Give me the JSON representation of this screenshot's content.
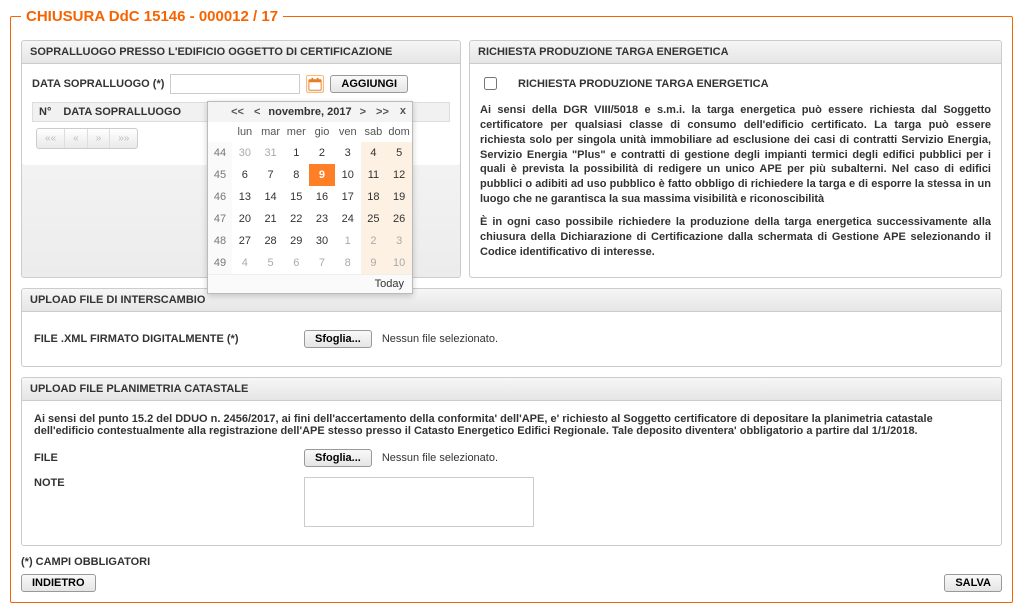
{
  "title": "CHIUSURA DdC 15146 - 000012 / 17",
  "sopralluogo": {
    "panel_title": "SOPRALLUOGO PRESSO L'EDIFICIO OGGETTO DI CERTIFICAZIONE",
    "date_label": "DATA SOPRALLUOGO (*)",
    "date_value": "",
    "aggiungi": "AGGIUNGI",
    "table_n": "N°",
    "table_date": "DATA SOPRALLUOGO",
    "nav_first": "««",
    "nav_prev": "«",
    "nav_next": "»",
    "nav_last": "»»"
  },
  "calendar": {
    "first": "<<",
    "prev": "<",
    "title": "novembre, 2017",
    "next": ">",
    "last": ">>",
    "close": "x",
    "dow": [
      "lun",
      "mar",
      "mer",
      "gio",
      "ven",
      "sab",
      "dom"
    ],
    "weeks": [
      {
        "wk": "44",
        "days": [
          {
            "d": "30",
            "o": true
          },
          {
            "d": "31",
            "o": true
          },
          {
            "d": "1"
          },
          {
            "d": "2"
          },
          {
            "d": "3"
          },
          {
            "d": "4",
            "we": true
          },
          {
            "d": "5",
            "we": true
          }
        ]
      },
      {
        "wk": "45",
        "days": [
          {
            "d": "6"
          },
          {
            "d": "7"
          },
          {
            "d": "8"
          },
          {
            "d": "9",
            "today": true
          },
          {
            "d": "10"
          },
          {
            "d": "11",
            "we": true
          },
          {
            "d": "12",
            "we": true
          }
        ]
      },
      {
        "wk": "46",
        "days": [
          {
            "d": "13"
          },
          {
            "d": "14"
          },
          {
            "d": "15"
          },
          {
            "d": "16"
          },
          {
            "d": "17"
          },
          {
            "d": "18",
            "we": true
          },
          {
            "d": "19",
            "we": true
          }
        ]
      },
      {
        "wk": "47",
        "days": [
          {
            "d": "20"
          },
          {
            "d": "21"
          },
          {
            "d": "22"
          },
          {
            "d": "23"
          },
          {
            "d": "24"
          },
          {
            "d": "25",
            "we": true
          },
          {
            "d": "26",
            "we": true
          }
        ]
      },
      {
        "wk": "48",
        "days": [
          {
            "d": "27"
          },
          {
            "d": "28"
          },
          {
            "d": "29"
          },
          {
            "d": "30"
          },
          {
            "d": "1",
            "o": true
          },
          {
            "d": "2",
            "o": true,
            "we": true
          },
          {
            "d": "3",
            "o": true,
            "we": true
          }
        ]
      },
      {
        "wk": "49",
        "days": [
          {
            "d": "4",
            "o": true
          },
          {
            "d": "5",
            "o": true
          },
          {
            "d": "6",
            "o": true
          },
          {
            "d": "7",
            "o": true
          },
          {
            "d": "8",
            "o": true
          },
          {
            "d": "9",
            "o": true,
            "we": true
          },
          {
            "d": "10",
            "o": true,
            "we": true
          }
        ]
      }
    ],
    "today": "Today"
  },
  "richiesta": {
    "panel_title": "RICHIESTA PRODUZIONE TARGA ENERGETICA",
    "checkbox_label": "RICHIESTA PRODUZIONE TARGA ENERGETICA",
    "p1": "Ai sensi della DGR VIII/5018 e s.m.i. la targa energetica può essere richiesta dal Soggetto certificatore per qualsiasi classe di consumo dell'edificio certificato. La targa può essere richiesta solo per singola unità immobiliare ad esclusione dei casi di contratti Servizio Energia, Servizio Energia \"Plus\" e contratti di gestione degli impianti termici degli edifici pubblici per i quali è prevista la possibilità di redigere un unico APE per più subalterni. Nel caso di edifici pubblici o adibiti ad uso pubblico è fatto obbligo di richiedere la targa e di esporre la stessa in un luogo che ne garantisca la sua massima visibilità e riconoscibilità",
    "p2": "È in ogni caso possibile richiedere la produzione della targa energetica successivamente alla chiusura della Dichiarazione di Certificazione dalla schermata di Gestione APE selezionando il Codice identificativo di interesse."
  },
  "upload_xml": {
    "panel_title": "UPLOAD FILE DI INTERSCAMBIO",
    "label": "FILE .XML FIRMATO DIGITALMENTE (*)",
    "browse": "Sfoglia...",
    "nofile": "Nessun file selezionato."
  },
  "upload_plan": {
    "panel_title": "UPLOAD FILE PLANIMETRIA CATASTALE",
    "intro": "Ai sensi del punto 15.2 del DDUO n. 2456/2017, ai fini dell'accertamento della conformita' dell'APE, e' richiesto al Soggetto certificatore di depositare la planimetria catastale dell'edificio contestualmente alla registrazione dell'APE stesso presso il Catasto Energetico Edifici Regionale. Tale deposito diventera' obbligatorio a partire dal 1/1/2018.",
    "file_label": "FILE",
    "browse": "Sfoglia...",
    "nofile": "Nessun file selezionato.",
    "note_label": "NOTE",
    "note_value": ""
  },
  "footer": {
    "mandatory": "(*) CAMPI OBBLIGATORI",
    "back": "INDIETRO",
    "save": "SALVA"
  }
}
